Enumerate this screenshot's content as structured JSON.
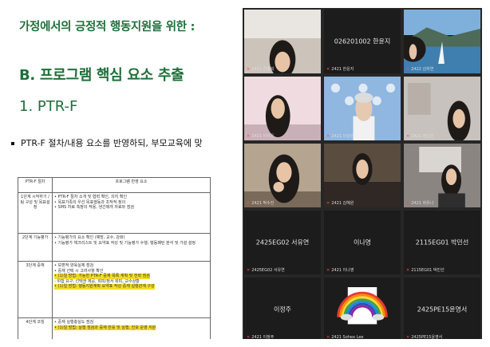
{
  "slide": {
    "title": "가정에서의 긍정적 행동지원을 위한 :",
    "section": "B. 프로그램 핵심 요소 추출",
    "subsection": "1. PTR-F",
    "bullet": "PTR-F 절차/내용 요소를 반영하되, 부모교육에 맞",
    "table": {
      "headers": [
        "PTR-F 절차",
        "프로그램 반영 요소"
      ],
      "rows": [
        {
          "step": "1단계 시작하기 / 팀 구성 및 목표설정",
          "lines": [
            "• PTR-F 절차 소개 및 협력 확인, 의지 확인",
            "• 목표가족의 우선 목표행동과 조작적 정의",
            "• SMS 자료 측정의 적용, 생긴매개 자료와 점검"
          ],
          "hl": []
        },
        {
          "step": "2단계 기능평가",
          "lines": [
            "• 기능평가의 요소 확인 (예방, 교수, 강화)",
            "• 기능평가 체크리스트 및 요약표 작성 및 기능평가 수행, 행동패턴 분석 및 가설 설정"
          ],
          "hl": []
        },
        {
          "step": "3단계 중재",
          "lines": [
            "• 보편적 양육실제 점검",
            "• 중재 선택 시 고려사항 확인",
            "• (1)일 방법: 가능한 PTR-F 중재 목록 계획 및 전략 점검",
            "  - 위험 요구, 선택권 제공, 회피/정서 회피, 교수상황",
            "• (1)일 방법: 행동지원계획 요약표 작성  중재 실행관계 구성"
          ],
          "hl": [
            2,
            4
          ]
        },
        {
          "step": "4단계 코칭",
          "lines": [
            "• 중재 실행충실도 점검",
            "• (1)일 방법: 실행 점검과 중재 반응 및 실행, 진보 운영 지원"
          ],
          "hl": [
            1
          ]
        }
      ]
    }
  },
  "participants": [
    {
      "id": "p1",
      "kind": "video",
      "scene": "person-close",
      "caption": "2421 연종희"
    },
    {
      "id": "p2",
      "kind": "name",
      "display": "026201002 한윤지",
      "caption": "2421 한윤지"
    },
    {
      "id": "p3",
      "kind": "video",
      "scene": "lake",
      "caption": "2422 김하연"
    },
    {
      "id": "p4",
      "kind": "video",
      "scene": "person-pink",
      "caption": "2421 이지은"
    },
    {
      "id": "p5",
      "kind": "video",
      "scene": "elder",
      "caption": "2421 이상민"
    },
    {
      "id": "p6",
      "kind": "video",
      "scene": "person-blur",
      "caption": "2421 정다은"
    },
    {
      "id": "p7",
      "kind": "video",
      "scene": "person-hand",
      "caption": "2421 박수진"
    },
    {
      "id": "p8",
      "kind": "video",
      "scene": "person-dark",
      "caption": "2421 김혜원"
    },
    {
      "id": "p9",
      "kind": "video",
      "scene": "person-room",
      "caption": "2421 최유나"
    },
    {
      "id": "p10",
      "kind": "name",
      "display": "2425EG02 서유연",
      "caption": "2425EG02 서유연"
    },
    {
      "id": "p11",
      "kind": "name",
      "display": "이나영",
      "caption": "2421 이나영"
    },
    {
      "id": "p12",
      "kind": "name",
      "display": "2115EG01 박민선",
      "caption": "2115EG01 박민선"
    },
    {
      "id": "p13",
      "kind": "name",
      "display": "이정주",
      "caption": "2421 이정주"
    },
    {
      "id": "p14",
      "kind": "video",
      "scene": "rainbow",
      "caption": "2421 Sohee Lee"
    },
    {
      "id": "p15",
      "kind": "name",
      "display": "2425PE15윤영서",
      "caption": "2425PE15윤영서"
    }
  ],
  "colors": {
    "slide_accent": "#1f6f3a",
    "grid_bg": "#262626",
    "tile_bg": "#1c1c1c",
    "mic_muted": "#ff4b4b",
    "highlight": "#f5dc2a"
  }
}
